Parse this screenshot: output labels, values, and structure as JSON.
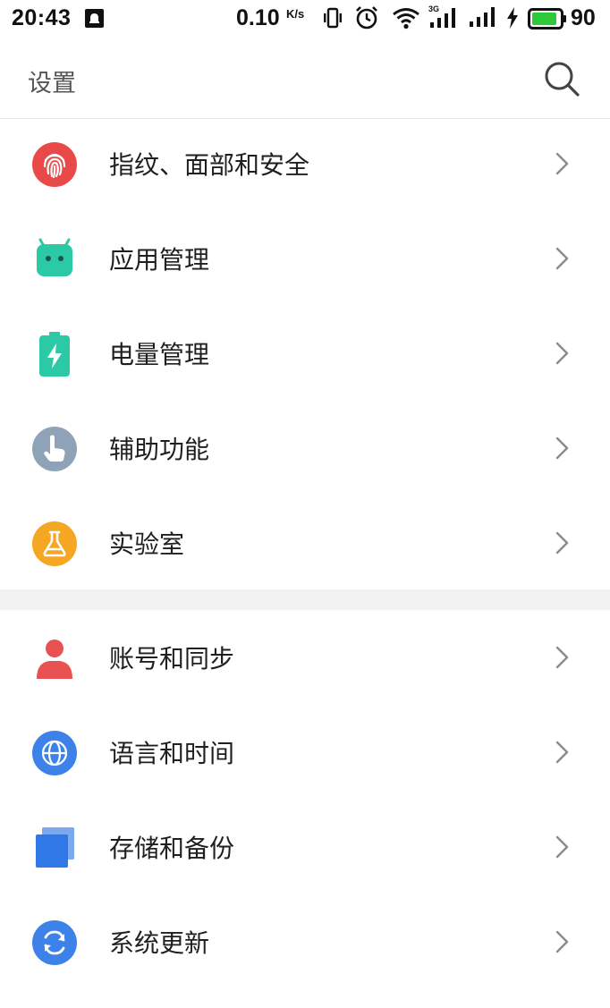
{
  "status_bar": {
    "time": "20:43",
    "net_speed": "0.10",
    "net_speed_unit": "K/s",
    "network_type": "3G",
    "battery_level": "90",
    "battery_color": "#2ec93a"
  },
  "header": {
    "title": "设置",
    "search_icon": "search-icon"
  },
  "groups": [
    {
      "items": [
        {
          "label": "指纹、面部和安全",
          "icon": "fingerprint-icon",
          "color": "#e84a4a"
        },
        {
          "label": "应用管理",
          "icon": "android-icon",
          "color": "#2bc9a6"
        },
        {
          "label": "电量管理",
          "icon": "battery-icon",
          "color": "#2bc9a6"
        },
        {
          "label": "辅助功能",
          "icon": "hand-pointer-icon",
          "color": "#8fa3b8"
        },
        {
          "label": "实验室",
          "icon": "flask-icon",
          "color": "#f5a623"
        }
      ]
    },
    {
      "items": [
        {
          "label": "账号和同步",
          "icon": "user-icon",
          "color": "#e85252"
        },
        {
          "label": "语言和时间",
          "icon": "globe-icon",
          "color": "#3d82e8"
        },
        {
          "label": "存储和备份",
          "icon": "storage-icon",
          "color": "#3d82e8"
        },
        {
          "label": "系统更新",
          "icon": "refresh-icon",
          "color": "#3d82e8"
        }
      ]
    }
  ]
}
